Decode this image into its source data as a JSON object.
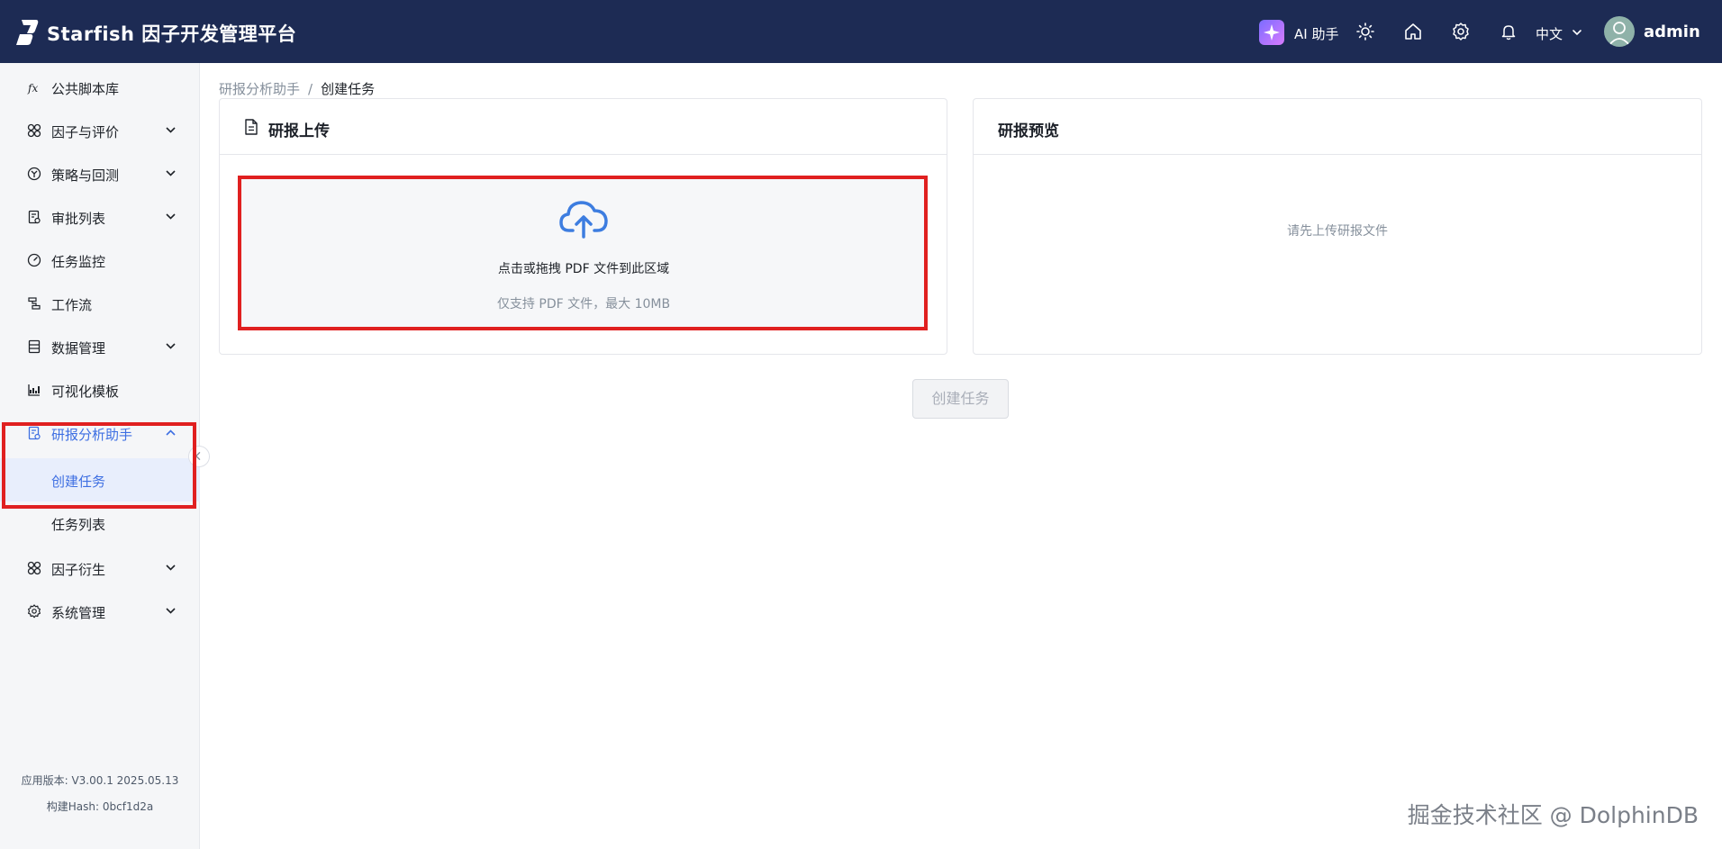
{
  "header": {
    "app_title": "Starfish 因子开发管理平台",
    "ai_label": "AI 助手",
    "language": "中文",
    "username": "admin",
    "icons": [
      "logo-icon",
      "ai-sparkle-icon",
      "theme-sun-icon",
      "home-icon",
      "settings-icon",
      "bell-icon",
      "chevron-down-icon",
      "user-avatar-icon"
    ]
  },
  "sidebar": {
    "items": [
      {
        "label": "公共脚本库",
        "icon": "function-icon"
      },
      {
        "label": "因子与评价",
        "icon": "factor-icon"
      },
      {
        "label": "策略与回测",
        "icon": "strategy-icon"
      },
      {
        "label": "审批列表",
        "icon": "approval-icon"
      },
      {
        "label": "任务监控",
        "icon": "gauge-icon"
      },
      {
        "label": "工作流",
        "icon": "workflow-icon"
      },
      {
        "label": "数据管理",
        "icon": "data-icon"
      },
      {
        "label": "可视化模板",
        "icon": "chart-icon"
      },
      {
        "label": "研报分析助手",
        "icon": "report-icon"
      },
      {
        "label": "因子衍生",
        "icon": "factor-derive-icon"
      },
      {
        "label": "系统管理",
        "icon": "gear-icon"
      }
    ],
    "sub_items": [
      {
        "label": "创建任务"
      },
      {
        "label": "任务列表"
      }
    ],
    "version": "应用版本: V3.00.1 2025.05.13",
    "build_hash": "构建Hash: 0bcf1d2a"
  },
  "breadcrumb": {
    "parent": "研报分析助手",
    "separator": "/",
    "current": "创建任务"
  },
  "upload_card": {
    "title": "研报上传",
    "main_text": "点击或拖拽 PDF 文件到此区域",
    "hint_text": "仅支持 PDF 文件，最大 10MB"
  },
  "preview_card": {
    "title": "研报预览",
    "empty_text": "请先上传研报文件"
  },
  "create_button": "创建任务",
  "watermark": "掘金技术社区 @ DolphinDB",
  "colors": {
    "header_bg": "#1d2b54",
    "accent": "#3e6fe2",
    "highlight": "#e02020"
  }
}
